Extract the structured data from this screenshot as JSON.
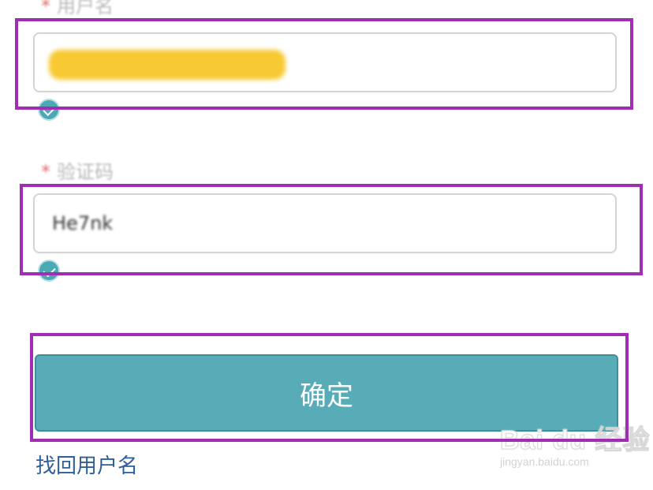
{
  "form": {
    "required_mark": "*",
    "username": {
      "label": "用户名",
      "value_redacted": true
    },
    "captcha": {
      "label": "验证码",
      "value": "He7nk"
    },
    "submit_label": "确定",
    "recover_link": "找回用户名"
  },
  "watermark": {
    "logo": "Bai du 经验",
    "url": "jingyan.baidu.com"
  },
  "colors": {
    "button_bg": "#58acb7",
    "highlight": "#a12db5",
    "link": "#2f5f9a",
    "redaction": "#f7c932",
    "check": "#4aa9b5",
    "required": "#e36f6f"
  },
  "icons": {
    "valid": "check-circle-icon"
  }
}
